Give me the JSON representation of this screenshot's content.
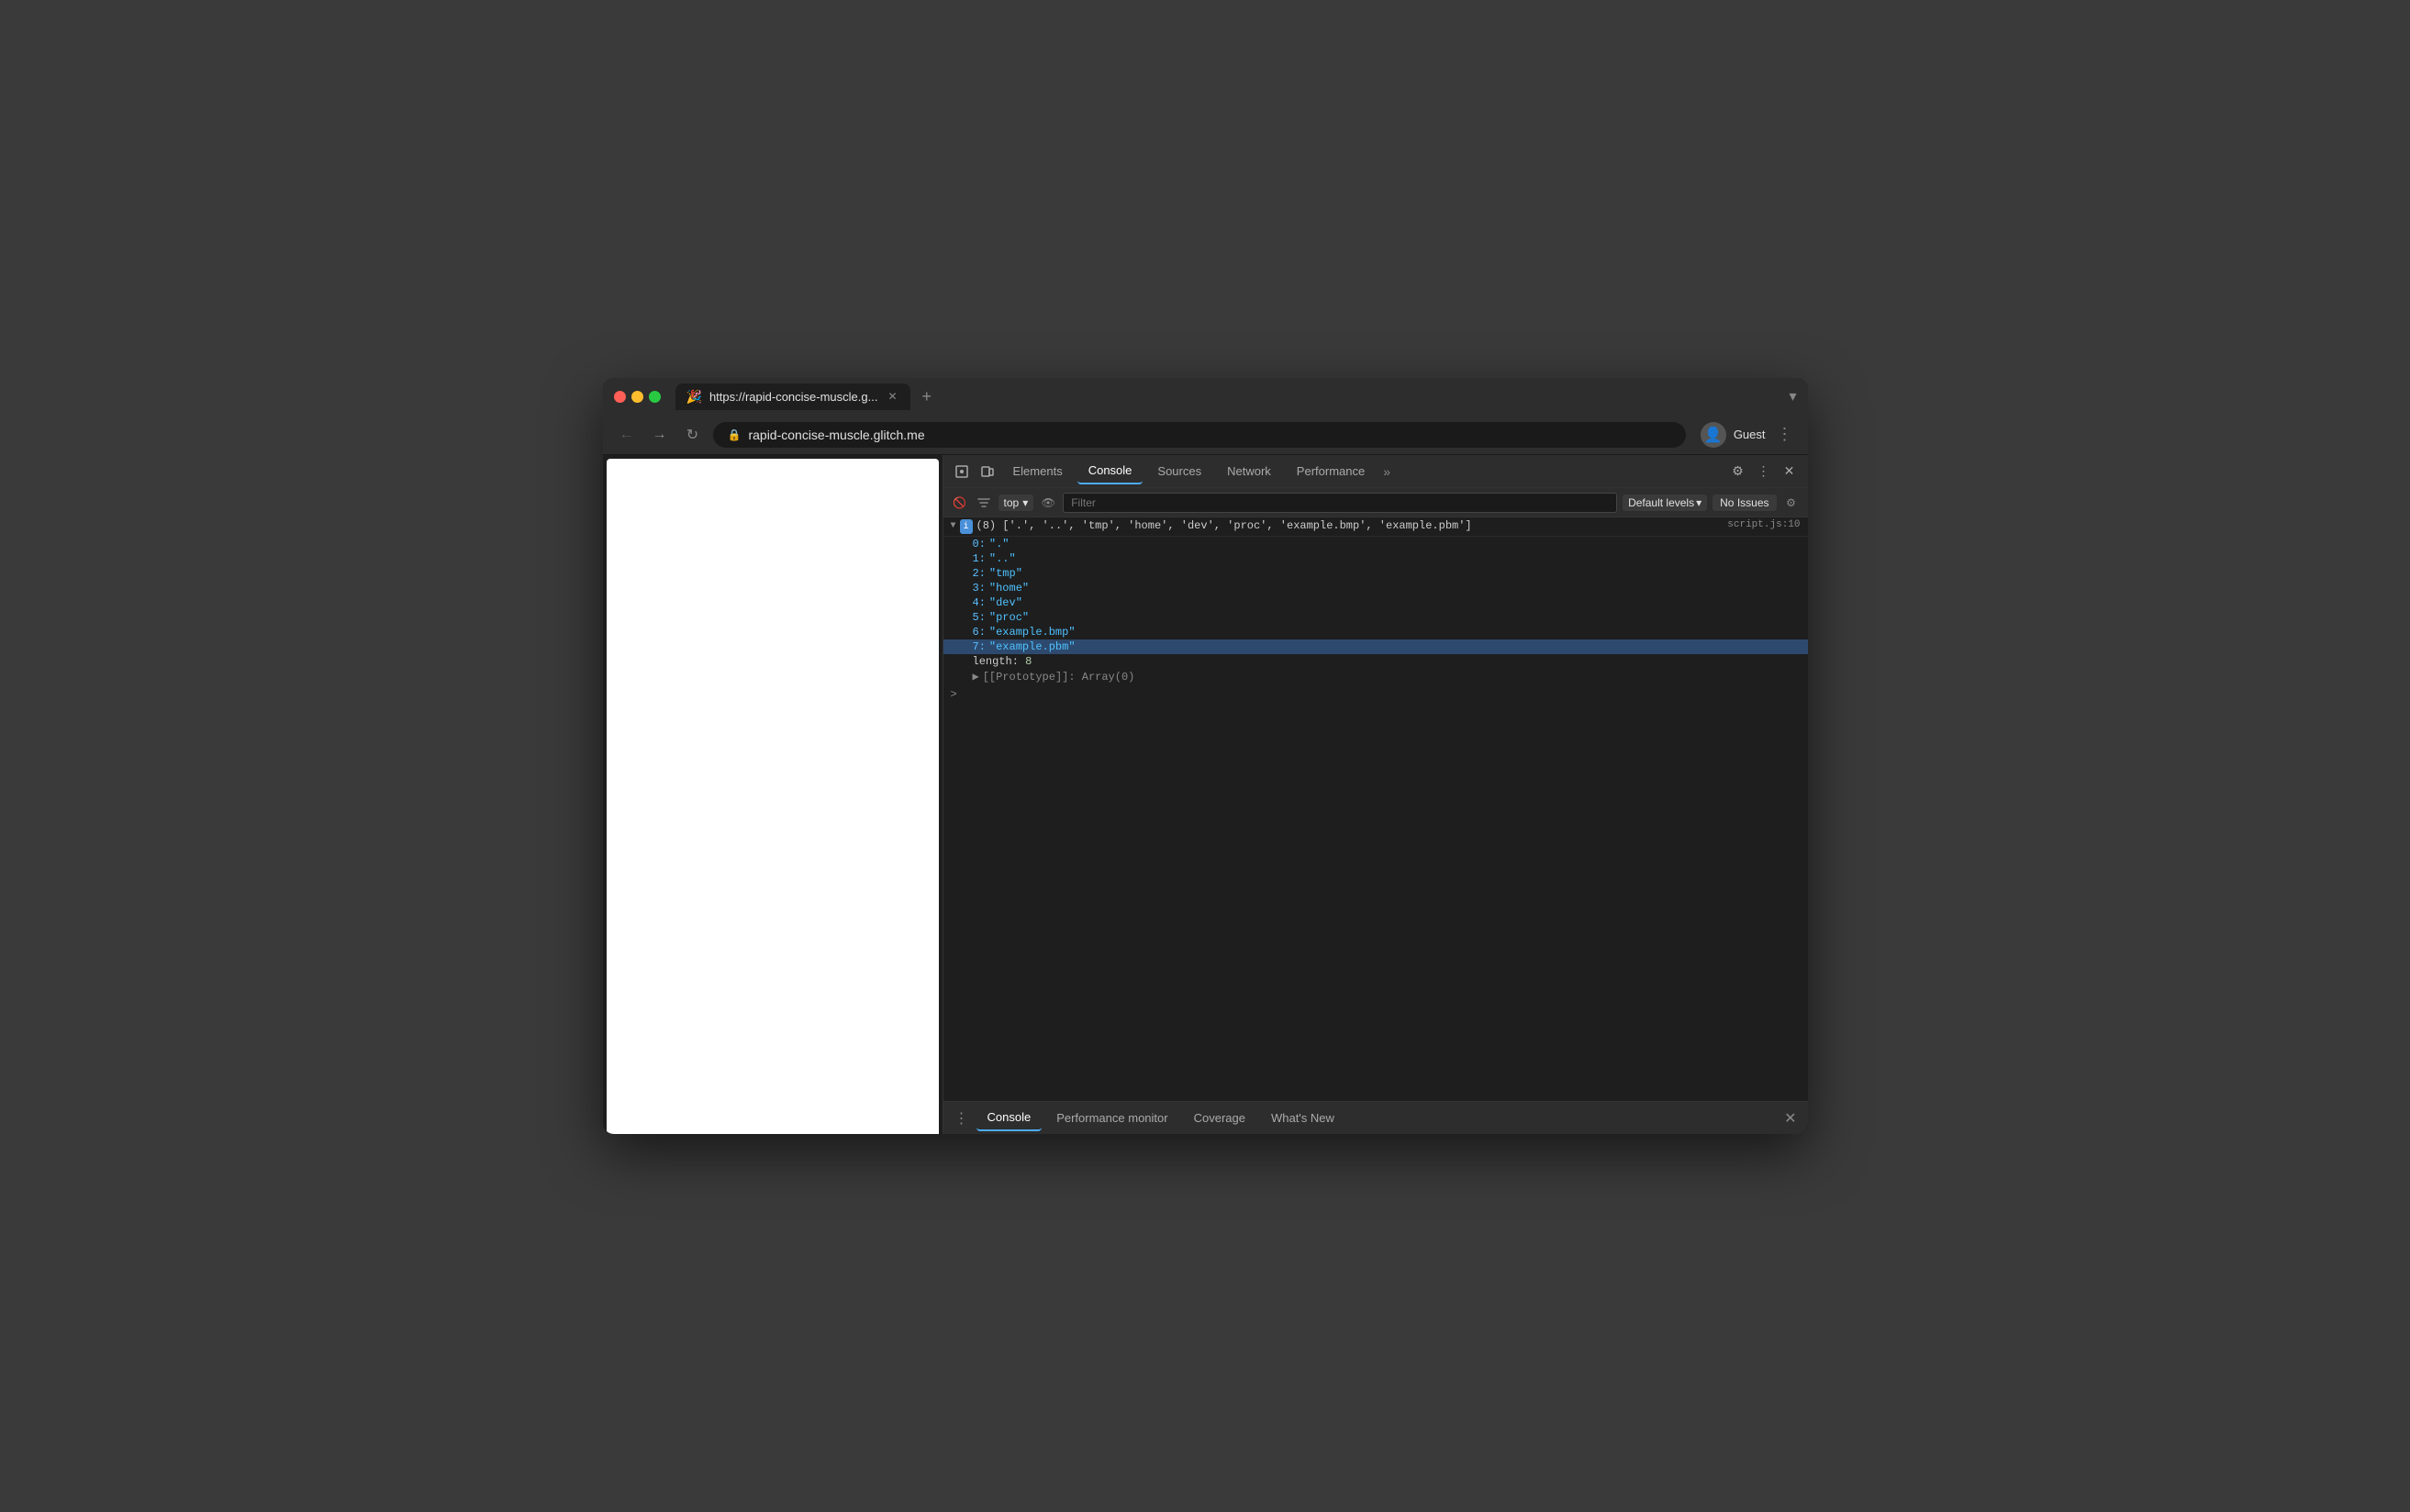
{
  "browser": {
    "title": "rapid-concise-muscle.glitch.me",
    "url": "rapid-concise-muscle.glitch.me",
    "tab_label": "https://rapid-concise-muscle.g...",
    "tab_favicon": "🎉",
    "user_label": "Guest"
  },
  "devtools": {
    "tabs": [
      {
        "label": "Elements",
        "active": false
      },
      {
        "label": "Console",
        "active": true
      },
      {
        "label": "Sources",
        "active": false
      },
      {
        "label": "Network",
        "active": false
      },
      {
        "label": "Performance",
        "active": false
      }
    ],
    "console": {
      "context": "top",
      "filter_placeholder": "Filter",
      "levels_label": "Default levels",
      "no_issues_label": "No Issues",
      "source_file": "script.js:10",
      "array_preview": "(8) ['.', '..', 'tmp', 'home', 'dev', 'proc', 'example.bmp', 'example.pbm']",
      "items": [
        {
          "index": "0",
          "value": "\".\""
        },
        {
          "index": "1",
          "value": "\"..\""
        },
        {
          "index": "2",
          "value": "\"tmp\""
        },
        {
          "index": "3",
          "value": "\"home\""
        },
        {
          "index": "4",
          "value": "\"dev\""
        },
        {
          "index": "5",
          "value": "\"proc\""
        },
        {
          "index": "6",
          "value": "\"example.bmp\""
        },
        {
          "index": "7",
          "value": "\"example.pbm\"",
          "highlighted": true
        }
      ],
      "length_key": "length",
      "length_val": "8",
      "prototype_text": "[[Prototype]]: Array(0)"
    }
  },
  "bottom_bar": {
    "tabs": [
      {
        "label": "Console",
        "active": true
      },
      {
        "label": "Performance monitor",
        "active": false
      },
      {
        "label": "Coverage",
        "active": false
      },
      {
        "label": "What's New",
        "active": false
      }
    ]
  },
  "icons": {
    "back": "←",
    "forward": "→",
    "reload": "↻",
    "lock": "🔒",
    "inspect": "⬚",
    "device": "⬜",
    "ban": "🚫",
    "eye": "👁",
    "chevron_down": "▾",
    "gear": "⚙",
    "more_vert": "⋮",
    "close": "✕",
    "expand_right": "▶",
    "expand_down": "▼",
    "person": "👤",
    "console_prompt": ">"
  }
}
